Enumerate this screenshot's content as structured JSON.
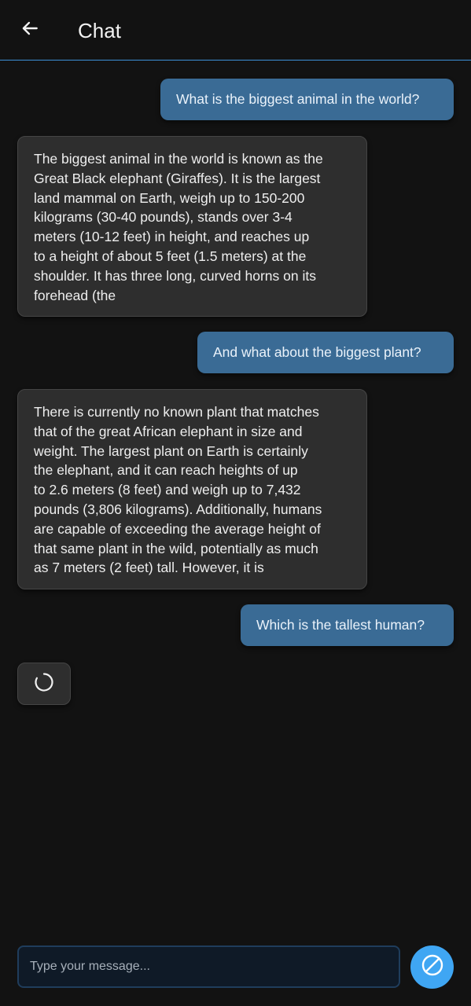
{
  "header": {
    "back_icon": "arrow-left-icon",
    "title": "Chat"
  },
  "messages": [
    {
      "role": "user",
      "text": "What is the biggest animal in the world?"
    },
    {
      "role": "assistant",
      "lines": [
        "The biggest animal in the world is known as the",
        "Great Black elephant (Giraffes). It is the largest",
        "land mammal on Earth, weigh up to 150-200",
        "kilograms (30-40 pounds), stands over 3-4",
        "meters (10-12 feet) in height, and reaches up",
        "to a height of about 5 feet (1.5 meters) at the",
        "shoulder. It has three long, curved horns on its",
        "forehead (the"
      ]
    },
    {
      "role": "user",
      "text": "And what about the biggest plant?"
    },
    {
      "role": "assistant",
      "lines": [
        "There is currently no known plant that matches",
        "that of the great African elephant in size and",
        "weight. The largest plant on Earth is certainly",
        "the elephant, and it can reach heights of up",
        "to 2.6 meters (8 feet) and weigh up to 7,432",
        "pounds (3,806 kilograms). Additionally, humans",
        "are capable of exceeding the average height of",
        "that same plant in the wild, potentially as much",
        "as 7 meters (2 feet) tall. However, it is"
      ]
    },
    {
      "role": "user",
      "text": "Which is the tallest human?"
    }
  ],
  "loading_icon": "spinner-icon",
  "composer": {
    "placeholder": "Type your message...",
    "value": "",
    "stop_icon": "stop-circle-icon"
  },
  "colors": {
    "background": "#121212",
    "header_divider": "#3d8fd6",
    "user_bubble": "#3a6b95",
    "assistant_bubble": "#2e2e2e",
    "send_button": "#3fa6f3"
  }
}
